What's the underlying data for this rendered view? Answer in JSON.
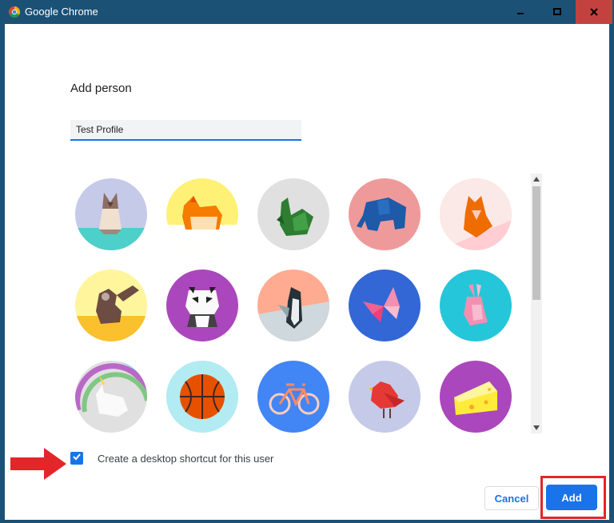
{
  "window": {
    "title": "Google Chrome",
    "icon": "chrome-icon",
    "controls": [
      "minimize-icon",
      "maximize-icon",
      "close-icon"
    ],
    "close_color": "#c3423f",
    "frame_color": "#1c5176"
  },
  "dialog": {
    "title": "Add person",
    "name_value": "Test Profile",
    "avatars": [
      {
        "name": "cat",
        "bg": "#c5cae9"
      },
      {
        "name": "corgi",
        "bg": "#fff176"
      },
      {
        "name": "dragon",
        "bg": "#e0e0e0"
      },
      {
        "name": "elephant",
        "bg": "#ef9a9a"
      },
      {
        "name": "fox",
        "bg": "#ffcdd2"
      },
      {
        "name": "monkey",
        "bg": "#fff59d"
      },
      {
        "name": "panda",
        "bg": "#ab47bc"
      },
      {
        "name": "penguin",
        "bg": "#ffab91"
      },
      {
        "name": "butterfly",
        "bg": "#3367d6"
      },
      {
        "name": "rabbit",
        "bg": "#26c6da"
      },
      {
        "name": "unicorn",
        "bg": "#e0e0e0"
      },
      {
        "name": "basketball",
        "bg": "#b2ebf2"
      },
      {
        "name": "bike",
        "bg": "#4285f4"
      },
      {
        "name": "bird",
        "bg": "#c5cae9"
      },
      {
        "name": "cheese",
        "bg": "#ab47bc"
      }
    ],
    "shortcut_checkbox": {
      "checked": true,
      "label": "Create a desktop shortcut for this user"
    },
    "cancel_label": "Cancel",
    "add_label": "Add",
    "accent_color": "#1a73e8",
    "annotation_color": "#e3262a"
  }
}
